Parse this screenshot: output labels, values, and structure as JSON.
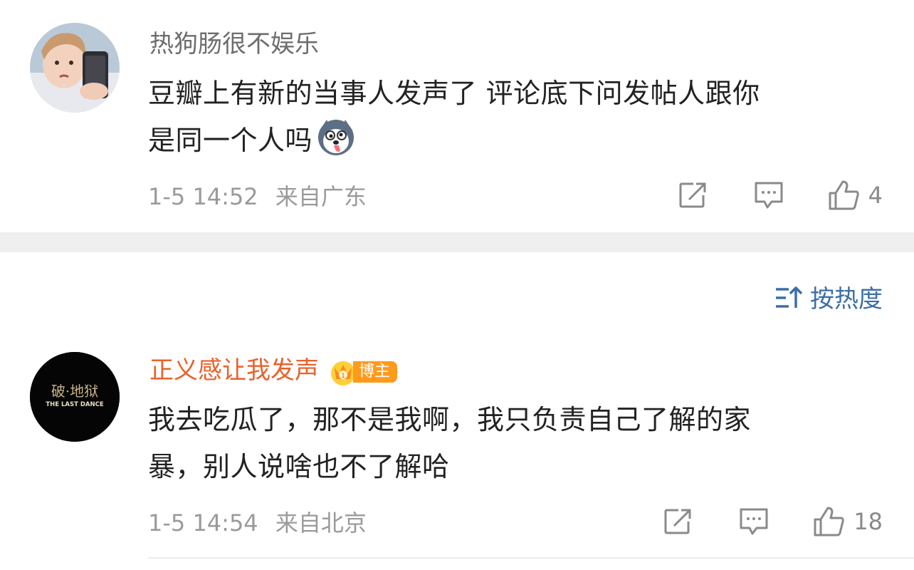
{
  "comments": [
    {
      "username": "热狗肠很不娱乐",
      "text_line1": "豆瓣上有新的当事人发声了 评论底下问发帖人跟你",
      "text_line2": "是同一个人吗",
      "time": "1-5 14:52",
      "location": "来自广东",
      "like_count": "4",
      "avatar": "child-with-phone-avatar",
      "emoji": "husky-tongue-emoji"
    },
    {
      "username": "正义感让我发声",
      "badge": "博主",
      "text_line1": "我去吃瓜了，那不是我啊，我只负责自己了解的家",
      "text_line2": "暴，别人说啥也不了解哈",
      "time": "1-5 14:54",
      "location": "来自北京",
      "like_count": "18",
      "avatar_text_1": "破·地狱",
      "avatar_text_2": "THE LAST DANCE"
    }
  ],
  "sort": {
    "label": "按热度",
    "icon": "sort-icon"
  },
  "icons": {
    "repost": "share-square-icon",
    "comment": "comment-bubble-icon",
    "like": "thumbs-up-icon",
    "badge": "crown-icon"
  },
  "colors": {
    "username_default": "#6d6d6d",
    "username_vip": "#e8622c",
    "meta": "#9a9a9a",
    "sort_blue": "#3b6ea8",
    "separator": "#efeff0",
    "badge_orange": "#ff9a1a"
  }
}
